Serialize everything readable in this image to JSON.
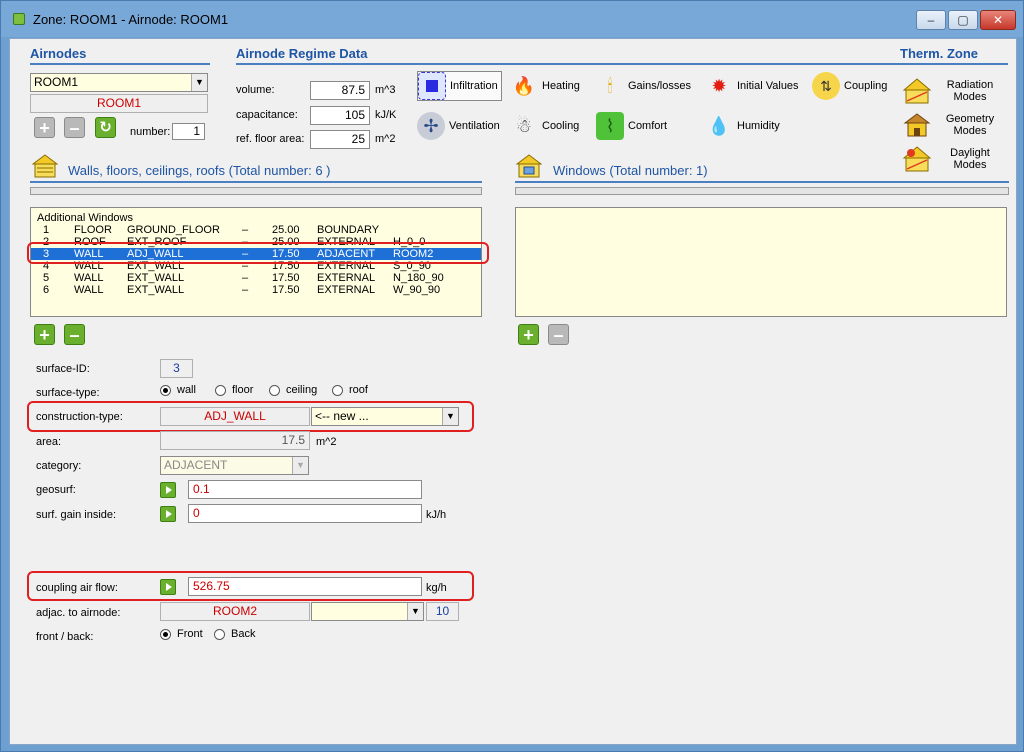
{
  "window": {
    "title": "Zone: ROOM1   -   Airnode: ROOM1",
    "min_label": "–",
    "max_label": "▢",
    "close_label": "✕"
  },
  "airnodes": {
    "title": "Airnodes",
    "selected": "ROOM1",
    "name_display": "ROOM1",
    "number_label": "number:",
    "number_value": "1",
    "add_label": "+",
    "remove_label": "–",
    "refresh_label": "↻"
  },
  "regime": {
    "title": "Airnode Regime Data",
    "volume_label": "volume:",
    "volume_value": "87.5",
    "volume_unit": "m^3",
    "capacitance_label": "capacitance:",
    "capacitance_value": "105",
    "capacitance_unit": "kJ/K",
    "floor_area_label": "ref. floor area:",
    "floor_area_value": "25",
    "floor_area_unit": "m^2",
    "items": {
      "infiltration": "Infiltration",
      "heating": "Heating",
      "gains": "Gains/losses",
      "initial": "Initial Values",
      "coupling": "Coupling",
      "ventilation": "Ventilation",
      "cooling": "Cooling",
      "comfort": "Comfort",
      "humidity": "Humidity"
    }
  },
  "therm_zone": {
    "title": "Therm. Zone",
    "radiation": "Radiation Modes",
    "geometry": "Geometry Modes",
    "daylight": "Daylight Modes"
  },
  "walls": {
    "title": "Walls, floors, ceilings, roofs (Total number: 6 )",
    "header": "Additional Windows",
    "rows": [
      {
        "n": "1",
        "type": "FLOOR",
        "name": "GROUND_FLOOR",
        "dash": "–",
        "area": "25.00",
        "cat": "BOUNDARY",
        "extra": ""
      },
      {
        "n": "2",
        "type": "ROOF",
        "name": "EXT_ROOF",
        "dash": "–",
        "area": "25.00",
        "cat": "EXTERNAL",
        "extra": "H_0_0"
      },
      {
        "n": "3",
        "type": "WALL",
        "name": "ADJ_WALL",
        "dash": "–",
        "area": "17.50",
        "cat": "ADJACENT",
        "extra": "ROOM2"
      },
      {
        "n": "4",
        "type": "WALL",
        "name": "EXT_WALL",
        "dash": "–",
        "area": "17.50",
        "cat": "EXTERNAL",
        "extra": "S_0_90"
      },
      {
        "n": "5",
        "type": "WALL",
        "name": "EXT_WALL",
        "dash": "–",
        "area": "17.50",
        "cat": "EXTERNAL",
        "extra": "N_180_90"
      },
      {
        "n": "6",
        "type": "WALL",
        "name": "EXT_WALL",
        "dash": "–",
        "area": "17.50",
        "cat": "EXTERNAL",
        "extra": "W_90_90"
      }
    ]
  },
  "windows": {
    "title": "Windows (Total number: 1)"
  },
  "surface": {
    "id_label": "surface-ID:",
    "id_value": "3",
    "type_label": "surface-type:",
    "type_options": [
      "wall",
      "floor",
      "ceiling",
      "roof"
    ],
    "construction_label": "construction-type:",
    "construction_value": "ADJ_WALL",
    "construction_combo": "<-- new ...",
    "area_label": "area:",
    "area_value": "17.5",
    "area_unit": "m^2",
    "category_label": "category:",
    "category_value": "ADJACENT",
    "geosurf_label": "geosurf:",
    "geosurf_value": "0.1",
    "gain_label": "surf. gain inside:",
    "gain_value": "0",
    "gain_unit": "kJ/h",
    "coupling_label": "coupling air flow:",
    "coupling_value": "526.75",
    "coupling_unit": "kg/h",
    "adjac_label": "adjac. to airnode:",
    "adjac_value": "ROOM2",
    "adjac_number": "10",
    "front_label": "front / back:",
    "front_option": "Front",
    "back_option": "Back"
  }
}
